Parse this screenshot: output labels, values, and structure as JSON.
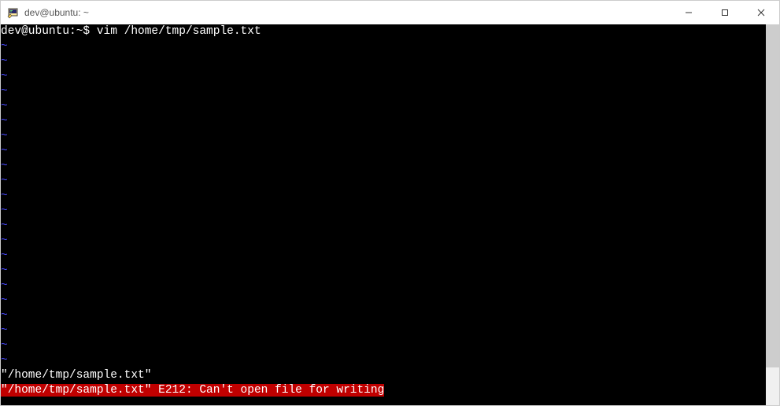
{
  "window": {
    "title": "dev@ubuntu: ~"
  },
  "terminal": {
    "prompt": "dev@ubuntu:~$ vim /home/tmp/sample.txt",
    "tilde": "~",
    "status_line": "\"/home/tmp/sample.txt\"",
    "error_line": "\"/home/tmp/sample.txt\" E212: Can't open file for writing"
  },
  "colors": {
    "terminal_bg": "#000000",
    "terminal_fg": "#ffffff",
    "tilde_color": "#4a4aff",
    "error_bg": "#c00000",
    "error_fg": "#ffffff"
  }
}
